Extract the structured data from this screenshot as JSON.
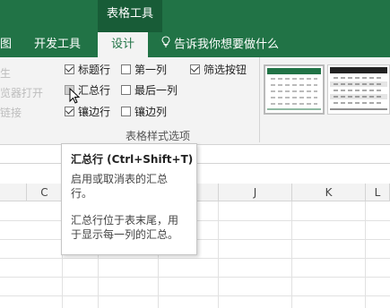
{
  "title_bar": {
    "context_tab": "表格工具"
  },
  "tabs": [
    {
      "label": "图"
    },
    {
      "label": "开发工具"
    },
    {
      "label": "设计",
      "active": true
    }
  ],
  "tell_me": {
    "label": "告诉我你想要做什么"
  },
  "ribbon": {
    "faded_items": [
      "生",
      "览器打开",
      "链接"
    ],
    "options": {
      "header_row": {
        "label": "标题行",
        "checked": true
      },
      "total_row": {
        "label": "汇总行",
        "checked": false
      },
      "banded_rows": {
        "label": "镶边行",
        "checked": true
      },
      "first_column": {
        "label": "第一列",
        "checked": false
      },
      "last_column": {
        "label": "最后一列",
        "checked": false
      },
      "banded_columns": {
        "label": "镶边列",
        "checked": false
      },
      "filter_button": {
        "label": "筛选按钮",
        "checked": true
      }
    },
    "group_label": "表格样式选项",
    "style_colors": {
      "accent": "#217346",
      "dark": "#222222"
    }
  },
  "columns": [
    "C",
    "J",
    "K",
    "L"
  ],
  "tooltip": {
    "title": "汇总行 (Ctrl+Shift+T)",
    "line1": "启用或取消表的汇总行。",
    "line2": "汇总行位于表末尾，用于显示每一列的汇总。"
  },
  "colors": {
    "brand": "#217346",
    "brand_dark": "#185c37",
    "ribbon_bg": "#f3f3f3"
  }
}
